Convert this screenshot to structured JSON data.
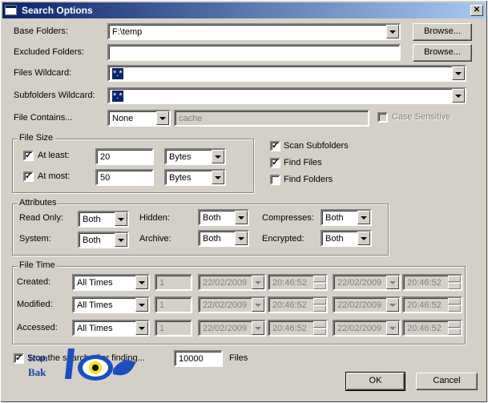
{
  "title": "Search Options",
  "close_label": "✕",
  "base_folders": {
    "label": "Base Folders:",
    "value": "F:\\temp",
    "browse": "Browse..."
  },
  "excluded_folders": {
    "label": "Excluded Folders:",
    "value": "",
    "browse": "Browse..."
  },
  "files_wildcard": {
    "label": "Files Wildcard:",
    "value": "*.*"
  },
  "subfolders_wildcard": {
    "label": "Subfolders Wildcard:",
    "value": "*.*"
  },
  "file_contains": {
    "label": "File Contains...",
    "mode": "None",
    "value": "cache",
    "case_sensitive": "Case Sensitive"
  },
  "file_size": {
    "title": "File Size",
    "at_least": {
      "label": "At least:",
      "value": "20",
      "unit": "Bytes"
    },
    "at_most": {
      "label": "At most:",
      "value": "50",
      "unit": "Bytes"
    }
  },
  "options": {
    "scan_subfolders": "Scan Subfolders",
    "find_files": "Find Files",
    "find_folders": "Find Folders"
  },
  "attributes": {
    "title": "Attributes",
    "read_only": {
      "label": "Read Only:",
      "value": "Both"
    },
    "system": {
      "label": "System:",
      "value": "Both"
    },
    "hidden": {
      "label": "Hidden:",
      "value": "Both"
    },
    "archive": {
      "label": "Archive:",
      "value": "Both"
    },
    "compresses": {
      "label": "Compresses:",
      "value": "Both"
    },
    "encrypted": {
      "label": "Encrypted:",
      "value": "Both"
    }
  },
  "file_time": {
    "title": "File Time",
    "created": {
      "label": "Created:",
      "mode": "All Times",
      "num": "1",
      "date1": "22/02/2009",
      "time1": "20:46:52",
      "date2": "22/02/2009",
      "time2": "20:46:52"
    },
    "modified": {
      "label": "Modified:",
      "mode": "All Times",
      "num": "1",
      "date1": "22/02/2009",
      "time1": "20:46:52",
      "date2": "22/02/2009",
      "time2": "20:46:52"
    },
    "accessed": {
      "label": "Accessed:",
      "mode": "All Times",
      "num": "1",
      "date1": "22/02/2009",
      "time1": "20:46:52",
      "date2": "22/02/2009",
      "time2": "20:46:52"
    }
  },
  "stop_search": {
    "label": "Stop the search after finding...",
    "value": "10000",
    "unit": "Files"
  },
  "watermark": {
    "line1": "Iran",
    "line2": "Bak"
  },
  "buttons": {
    "ok": "OK",
    "cancel": "Cancel"
  },
  "colors": {
    "title_start": "#0a246a",
    "title_end": "#a6caf0",
    "face": "#d4d0c8",
    "selection": "#0a246a"
  }
}
